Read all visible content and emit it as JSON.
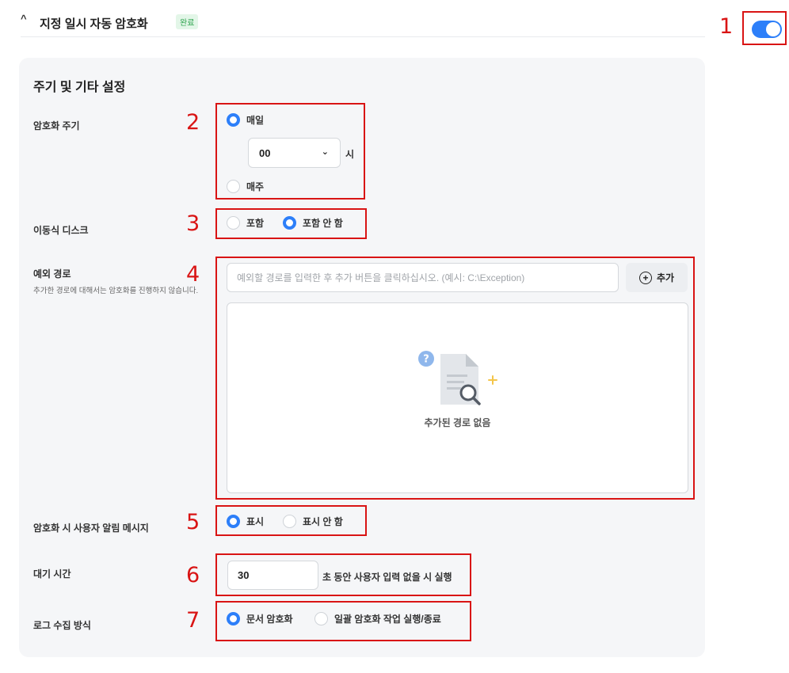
{
  "header": {
    "title": "지정 일시 자동 암호화",
    "badge": "완료",
    "toggle_on": true
  },
  "annotations": [
    "1",
    "2",
    "3",
    "4",
    "5",
    "6",
    "7"
  ],
  "panel": {
    "title": "주기 및 기타 설정"
  },
  "cycle": {
    "label": "암호화 주기",
    "daily_label": "매일",
    "hour_value": "00",
    "hour_unit": "시",
    "weekly_label": "매주",
    "selected": "daily"
  },
  "removable": {
    "label": "이동식 디스크",
    "include_label": "포함",
    "exclude_label": "포함 안 함",
    "selected": "exclude"
  },
  "exception": {
    "label": "예외 경로",
    "description": "추가한 경로에 대해서는 암호화를 진행하지 않습니다.",
    "placeholder": "예외할 경로를 입력한 후 추가 버튼을 클릭하십시오. (예시: C:\\Exception)",
    "add_label": "추가",
    "empty_text": "추가된 경로 없음"
  },
  "notification": {
    "label": "암호화 시 사용자 알림 메시지",
    "show_label": "표시",
    "hide_label": "표시 안 함",
    "selected": "show"
  },
  "wait": {
    "label": "대기 시간",
    "value": "30",
    "suffix": "초 동안 사용자 입력 없을 시 실행"
  },
  "log": {
    "label": "로그 수집 방식",
    "doc_label": "문서 암호화",
    "batch_label": "일괄 암호화 작업 실행/종료",
    "selected": "doc"
  },
  "colors": {
    "accent": "#2d7ff9",
    "annotation": "#d91414",
    "panel_bg": "#f5f6f8"
  }
}
